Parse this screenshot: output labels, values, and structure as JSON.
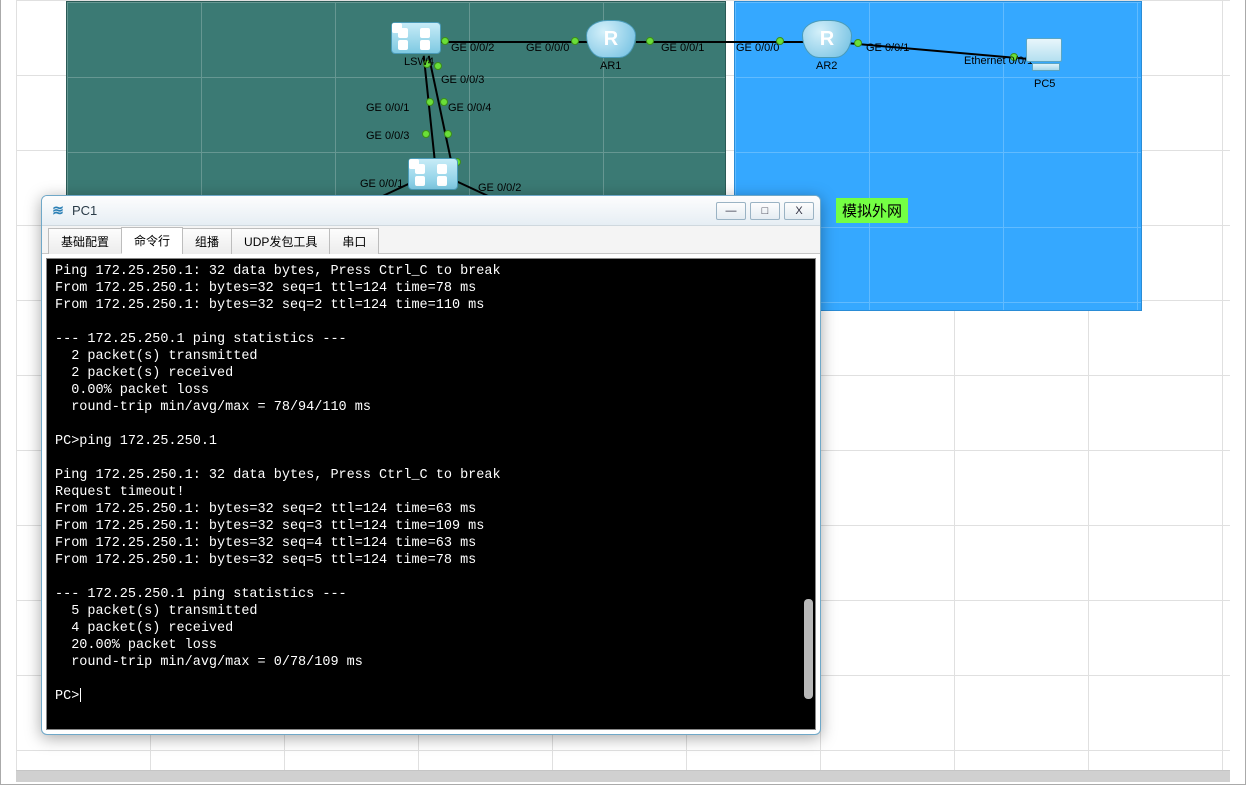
{
  "zone_label": "模拟外网",
  "devices": {
    "lsw4": "LSW4",
    "ar1": "AR1",
    "ar2": "AR2",
    "pc5": "PC5"
  },
  "iface": {
    "ge002_a": "GE 0/0/2",
    "ge000_a": "GE 0/0/0",
    "ge001_a": "GE 0/0/1",
    "ge000_b": "GE 0/0/0",
    "ge001_b": "GE 0/0/1",
    "eth001": "Ethernet 0/0/1",
    "ge003_a": "GE 0/0/3",
    "ge001_c": "GE 0/0/1",
    "ge004": "GE 0/0/4",
    "ge003_b": "GE 0/0/3",
    "ge001_d": "GE 0/0/1",
    "ge002_b": "GE 0/0/2"
  },
  "dialog": {
    "title": "PC1",
    "tabs": [
      "基础配置",
      "命令行",
      "组播",
      "UDP发包工具",
      "串口"
    ],
    "active_tab": 1,
    "lines": [
      "Ping 172.25.250.1: 32 data bytes, Press Ctrl_C to break",
      "From 172.25.250.1: bytes=32 seq=1 ttl=124 time=78 ms",
      "From 172.25.250.1: bytes=32 seq=2 ttl=124 time=110 ms",
      "",
      "--- 172.25.250.1 ping statistics ---",
      "  2 packet(s) transmitted",
      "  2 packet(s) received",
      "  0.00% packet loss",
      "  round-trip min/avg/max = 78/94/110 ms",
      "",
      "PC>ping 172.25.250.1",
      "",
      "Ping 172.25.250.1: 32 data bytes, Press Ctrl_C to break",
      "Request timeout!",
      "From 172.25.250.1: bytes=32 seq=2 ttl=124 time=63 ms",
      "From 172.25.250.1: bytes=32 seq=3 ttl=124 time=109 ms",
      "From 172.25.250.1: bytes=32 seq=4 ttl=124 time=63 ms",
      "From 172.25.250.1: bytes=32 seq=5 ttl=124 time=78 ms",
      "",
      "--- 172.25.250.1 ping statistics ---",
      "  5 packet(s) transmitted",
      "  4 packet(s) received",
      "  20.00% packet loss",
      "  round-trip min/avg/max = 0/78/109 ms",
      "",
      "PC>"
    ]
  },
  "winbuttons": {
    "min": "—",
    "max": "□",
    "close": "X"
  }
}
